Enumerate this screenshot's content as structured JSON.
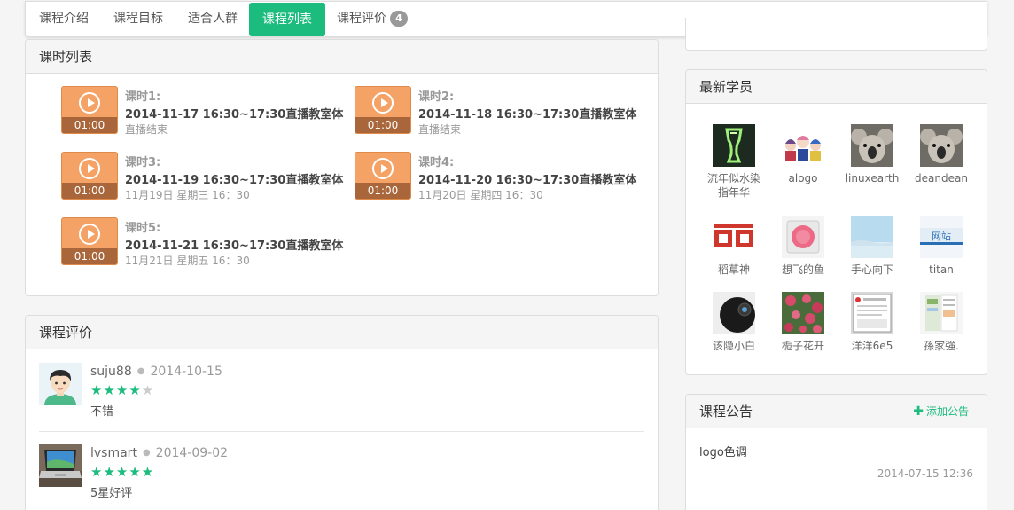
{
  "tabs": [
    {
      "label": "课程介绍"
    },
    {
      "label": "课程目标"
    },
    {
      "label": "适合人群"
    },
    {
      "label": "课程列表"
    },
    {
      "label": "课程评价",
      "count": "4"
    }
  ],
  "active_tab": "课程列表",
  "lessons_panel": {
    "title": "课时列表",
    "lessons": [
      {
        "title": "课时1:",
        "time": "2014-11-17 16:30~17:30直播教室体",
        "status": "直播结束",
        "duration": "01:00"
      },
      {
        "title": "课时2:",
        "time": "2014-11-18 16:30~17:30直播教室体",
        "status": "直播结束",
        "duration": "01:00"
      },
      {
        "title": "课时3:",
        "time": "2014-11-19 16:30~17:30直播教室体",
        "status": "11月19日 星期三 16：30",
        "duration": "01:00"
      },
      {
        "title": "课时4:",
        "time": "2014-11-20 16:30~17:30直播教室体",
        "status": "11月20日 星期四 16：30",
        "duration": "01:00"
      },
      {
        "title": "课时5:",
        "time": "2014-11-21 16:30~17:30直播教室体",
        "status": "11月21日 星期五 16：30",
        "duration": "01:00"
      }
    ]
  },
  "reviews_panel": {
    "title": "课程评价",
    "reviews": [
      {
        "user": "suju88",
        "date": "2014-10-15",
        "rating": 4,
        "max_rating": 5,
        "text": "不错"
      },
      {
        "user": "lvsmart",
        "date": "2014-09-02",
        "rating": 5,
        "max_rating": 5,
        "text": "5星好评"
      }
    ]
  },
  "students_panel": {
    "title": "最新学员",
    "students": [
      {
        "name": "流年似水染指年华"
      },
      {
        "name": "alogo"
      },
      {
        "name": "linuxearth"
      },
      {
        "name": "deandean"
      },
      {
        "name": "稻草神"
      },
      {
        "name": "想飞的鱼"
      },
      {
        "name": "手心向下"
      },
      {
        "name": "titan"
      },
      {
        "name": "该隐小白"
      },
      {
        "name": "栀子花开"
      },
      {
        "name": "洋洋6e5"
      },
      {
        "name": "孫家強."
      }
    ]
  },
  "notice_panel": {
    "title": "课程公告",
    "add_label": "添加公告",
    "notice_text": "logo色调",
    "notice_time": "2014-07-15 12:36"
  },
  "colors": {
    "accent": "#1bbc7d",
    "lesson_thumb": "#f5a266",
    "thumb_bar": "#a8663a"
  }
}
